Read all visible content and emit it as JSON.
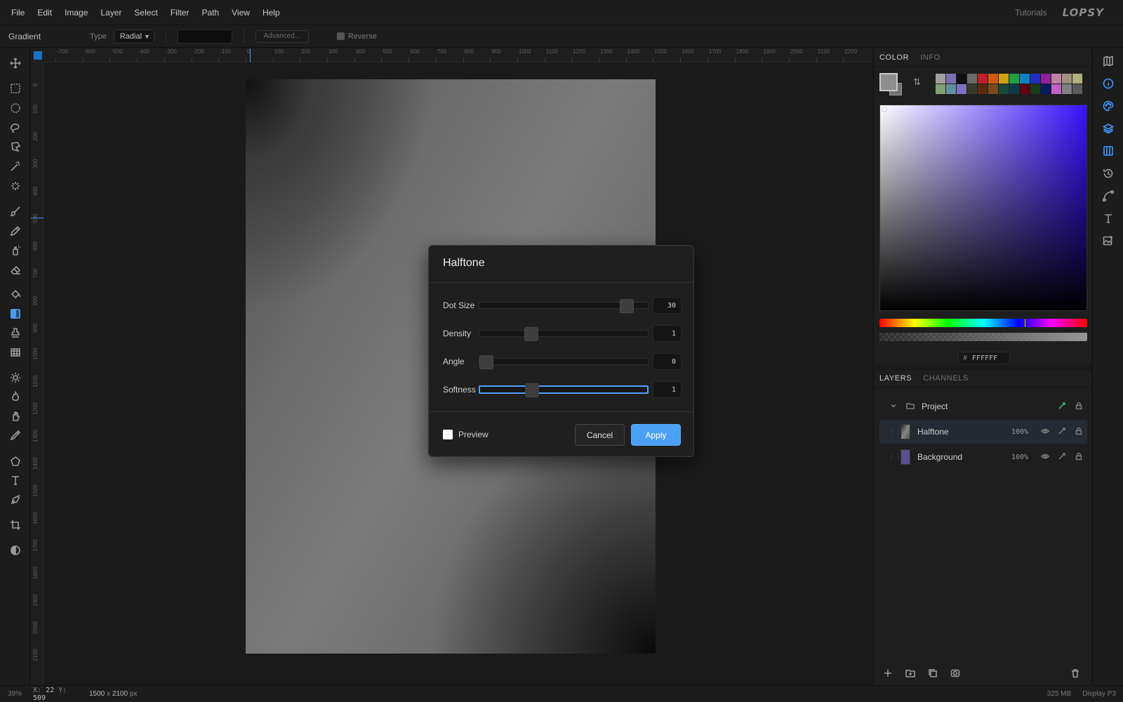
{
  "menubar": {
    "items": [
      "File",
      "Edit",
      "Image",
      "Layer",
      "Select",
      "Filter",
      "Path",
      "View",
      "Help"
    ],
    "tutorials": "Tutorials",
    "logo": "LOPSY"
  },
  "options": {
    "tool_name": "Gradient",
    "type_label": "Type",
    "type_value": "Radial",
    "advanced_label": "Advanced...",
    "reverse_label": "Reverse"
  },
  "ruler": {
    "top_ticks": [
      "-700",
      "-600",
      "-500",
      "-400",
      "-300",
      "-200",
      "-100",
      "0",
      "100",
      "200",
      "300",
      "400",
      "500",
      "600",
      "700",
      "800",
      "900",
      "1000",
      "1100",
      "1200",
      "1300",
      "1400",
      "1500",
      "1600",
      "1700",
      "1800",
      "1900",
      "2000",
      "2100",
      "2200"
    ],
    "left_ticks": [
      "0",
      "100",
      "200",
      "300",
      "400",
      "500",
      "600",
      "700",
      "800",
      "900",
      "1000",
      "1100",
      "1200",
      "1300",
      "1400",
      "1500",
      "1600",
      "1700",
      "1800",
      "1900",
      "2000",
      "2100"
    ]
  },
  "tools": [
    {
      "icon": "move-icon"
    },
    {
      "icon": "rect-select-icon"
    },
    {
      "icon": "ellipse-select-icon"
    },
    {
      "icon": "lasso-icon"
    },
    {
      "icon": "polygon-lasso-icon"
    },
    {
      "icon": "magic-wand-icon"
    },
    {
      "icon": "quick-select-icon"
    },
    {
      "icon": "brush-icon"
    },
    {
      "icon": "pencil-icon"
    },
    {
      "icon": "spray-icon"
    },
    {
      "icon": "eraser-icon"
    },
    {
      "icon": "fill-icon"
    },
    {
      "icon": "gradient-icon",
      "active": true
    },
    {
      "icon": "stamp-icon"
    },
    {
      "icon": "pattern-icon"
    },
    {
      "icon": "dodge-icon"
    },
    {
      "icon": "burn-icon"
    },
    {
      "icon": "smudge-icon"
    },
    {
      "icon": "eyedropper-icon"
    },
    {
      "icon": "shape-icon"
    },
    {
      "icon": "text-icon"
    },
    {
      "icon": "pen-icon"
    },
    {
      "icon": "crop-icon"
    },
    {
      "icon": "contrast-icon"
    }
  ],
  "color_panel": {
    "tabs": [
      "COLOR",
      "INFO"
    ],
    "hex_hash": "#",
    "hex_value": "FFFFFF",
    "swatches": [
      "#a0a0a0",
      "#7a6fb0",
      "#101010",
      "#6a6a6a",
      "#c0202a",
      "#d05a10",
      "#d0a010",
      "#20a040",
      "#1080c0",
      "#2030c0",
      "#9020a0",
      "#c080a0",
      "#a09080",
      "#b0b080",
      "#80a070",
      "#6090a0",
      "#8070c0",
      "#3a3a2a",
      "#5a2a10",
      "#7a4a20",
      "#1a4a3a",
      "#0a3a4a",
      "#600010",
      "#1a3a1a",
      "#0a1a60",
      "#c060c0",
      "#808080",
      "#5a5a5a",
      "#d07010"
    ]
  },
  "layers_panel": {
    "tabs": [
      "LAYERS",
      "CHANNELS"
    ],
    "project": "Project",
    "layers": [
      {
        "name": "Halftone",
        "opacity": "100%",
        "selected": true
      },
      {
        "name": "Background",
        "opacity": "100%",
        "selected": false
      }
    ]
  },
  "statusbar": {
    "zoom": "39%",
    "x_label": "X:",
    "x_value": "22",
    "y_label": "Y:",
    "y_value": "509",
    "doc_w": "1500",
    "doc_x": "x",
    "doc_h": "2100",
    "doc_unit": "px",
    "memory": "325 MB",
    "profile": "Display P3"
  },
  "dialog": {
    "title": "Halftone",
    "sliders": [
      {
        "label": "Dot Size",
        "value": "30",
        "fraction": 0.9
      },
      {
        "label": "Density",
        "value": "1",
        "fraction": 0.29
      },
      {
        "label": "Angle",
        "value": "0",
        "fraction": 0.0
      },
      {
        "label": "Softness",
        "value": "1",
        "fraction": 0.29,
        "focused": true
      }
    ],
    "preview_label": "Preview",
    "cancel_label": "Cancel",
    "apply_label": "Apply"
  }
}
